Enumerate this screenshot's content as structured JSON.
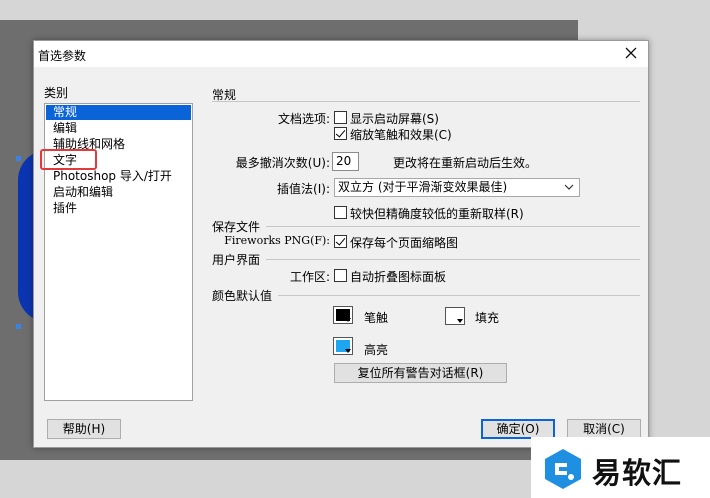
{
  "dialog": {
    "title": "首选参数"
  },
  "categories": {
    "label": "类别",
    "items": [
      "常规",
      "编辑",
      "辅助线和网格",
      "文字",
      "Photoshop 导入/打开",
      "启动和编辑",
      "插件"
    ],
    "selected_index": 0
  },
  "general": {
    "section_title": "常规",
    "doc_options_label": "文档选项:",
    "show_startup_screen": {
      "label": "显示启动屏幕(S)",
      "checked": false
    },
    "scale_strokes": {
      "label": "缩放笔触和效果(C)",
      "checked": true
    },
    "max_undo_label": "最多撤消次数(U):",
    "max_undo_value": "20",
    "restart_note": "更改将在重新启动后生效。",
    "interpolation_label": "插值法(I):",
    "interpolation_value": "双立方 (对于平滑渐变效果最佳)",
    "faster_resample": {
      "label": "较快但精确度较低的重新取样(R)",
      "checked": false
    }
  },
  "save_files": {
    "section_title": "保存文件",
    "fw_png_label": "Fireworks PNG(F):",
    "save_thumbnails": {
      "label": "保存每个页面缩略图",
      "checked": true
    }
  },
  "ui": {
    "section_title": "用户界面",
    "workspace_label": "工作区:",
    "auto_collapse": {
      "label": "自动折叠图标面板",
      "checked": false
    }
  },
  "colors": {
    "section_title": "颜色默认值",
    "stroke": {
      "label": "笔触",
      "color": "#000000"
    },
    "fill": {
      "label": "填充",
      "color": "#ffffff"
    },
    "highlight": {
      "label": "高亮",
      "color": "#1fa6f0"
    },
    "reset_button": "复位所有警告对话框(R)"
  },
  "buttons": {
    "help": "帮助(H)",
    "ok": "确定(O)",
    "cancel": "取消(C)"
  },
  "watermark": {
    "text": "易软汇"
  },
  "theme": {
    "selection_blue": "#0a64d8",
    "annotation_red": "#e23a3a"
  }
}
